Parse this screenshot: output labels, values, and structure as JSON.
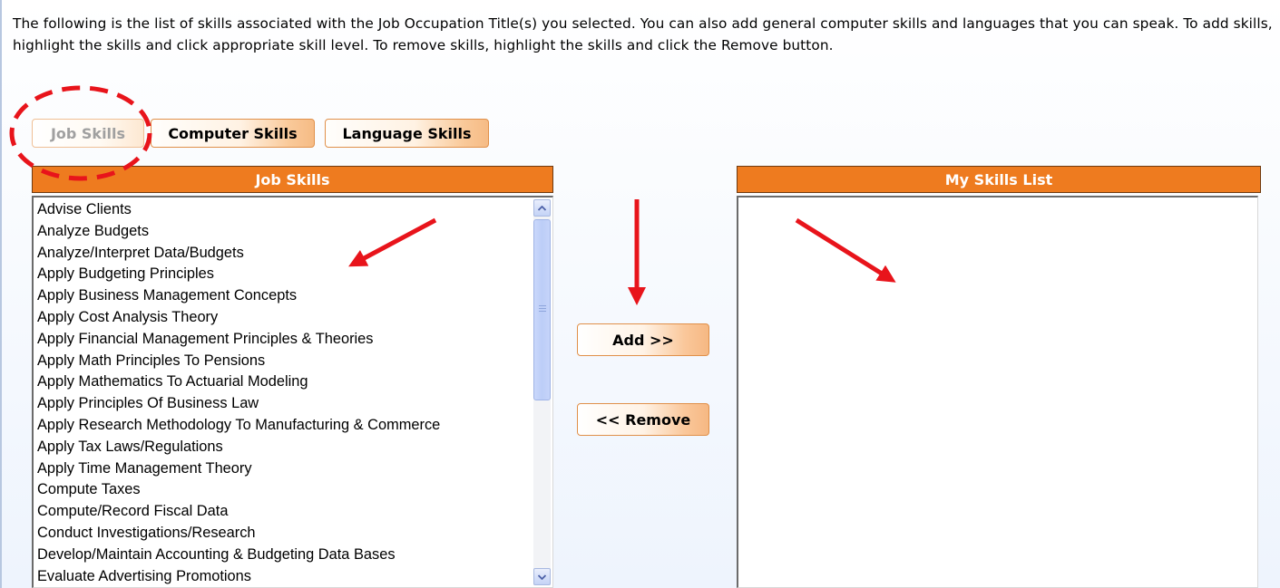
{
  "intro_text": "The following is the list of skills associated with the Job Occupation Title(s) you selected. You can also add general computer skills and languages that you can speak. To add skills, highlight the skills and click appropriate skill level. To remove skills, highlight the skills and click the Remove button.",
  "tabs": [
    {
      "label": "Job Skills",
      "state": "disabled"
    },
    {
      "label": "Computer Skills",
      "state": "enabled"
    },
    {
      "label": "Language Skills",
      "state": "enabled"
    }
  ],
  "left_panel": {
    "title": "Job Skills",
    "items": [
      "Advise Clients",
      "Analyze Budgets",
      "Analyze/Interpret Data/Budgets",
      "Apply Budgeting Principles",
      "Apply Business Management Concepts",
      "Apply Cost Analysis Theory",
      "Apply Financial Management Principles & Theories",
      "Apply Math Principles To Pensions",
      "Apply Mathematics To Actuarial Modeling",
      "Apply Principles Of Business Law",
      "Apply Research Methodology To Manufacturing & Commerce",
      "Apply Tax Laws/Regulations",
      "Apply Time Management Theory",
      "Compute Taxes",
      "Compute/Record Fiscal Data",
      "Conduct Investigations/Research",
      "Develop/Maintain Accounting & Budgeting Data Bases",
      "Evaluate Advertising Promotions"
    ]
  },
  "right_panel": {
    "title": "My Skills List",
    "items": []
  },
  "buttons": {
    "add": "Add >>",
    "remove": "<< Remove"
  },
  "colors": {
    "header_orange": "#EE7B1F",
    "annotation_red": "#E8141B",
    "scrollbar_blue": "#C4D3F6"
  },
  "icons": [
    "scroll-up-arrow-icon",
    "scroll-down-arrow-icon",
    "scroll-grip-icon"
  ]
}
